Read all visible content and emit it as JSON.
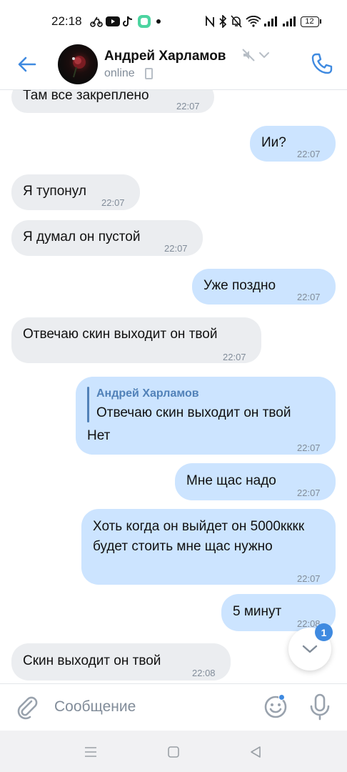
{
  "status_bar": {
    "time": "22:18",
    "battery": "12",
    "left_icons": [
      "bike-icon",
      "youtube-icon",
      "tiktok-icon",
      "app-icon",
      "dot-icon"
    ],
    "right_icons": [
      "nfc-icon",
      "bluetooth-icon",
      "mute-bell-icon",
      "wifi-icon",
      "signal-icon",
      "signal-icon",
      "battery-icon"
    ]
  },
  "header": {
    "name": "Андрей Харламов",
    "status": "online"
  },
  "messages": [
    {
      "dir": "in",
      "text": "Там все закреплено",
      "time": "22:07"
    },
    {
      "dir": "out",
      "text": "Ии?",
      "time": "22:07"
    },
    {
      "dir": "in",
      "text": "Я тупонул",
      "time": "22:07"
    },
    {
      "dir": "in",
      "text": "Я думал он пустой",
      "time": "22:07"
    },
    {
      "dir": "out",
      "text": "Уже поздно",
      "time": "22:07"
    },
    {
      "dir": "in",
      "text": "Отвечаю скин выходит он твой",
      "time": "22:07"
    },
    {
      "dir": "out",
      "reply_author": "Андрей Харламов",
      "reply_text": "Отвечаю скин выходит он твой",
      "text": "Нет",
      "time": "22:07"
    },
    {
      "dir": "out",
      "text": "Мне щас надо",
      "time": "22:07"
    },
    {
      "dir": "out",
      "text": "Хоть когда он выйдет он 5000кккк будет стоить мне щас нужно",
      "time": "22:07"
    },
    {
      "dir": "out",
      "text": "5 минут",
      "time": "22:08"
    },
    {
      "dir": "in",
      "text": "Скин выходит он твой",
      "time": "22:08"
    }
  ],
  "scroll_badge": "1",
  "composer": {
    "placeholder": "Сообщение"
  },
  "colors": {
    "accent": "#3f8ae0",
    "incoming_bubble": "#ebedf0",
    "outgoing_bubble": "#cce4ff",
    "secondary_text": "#818c99"
  }
}
